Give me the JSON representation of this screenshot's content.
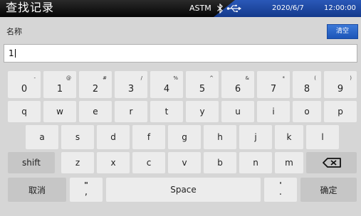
{
  "status_bar": {
    "title": "查找记录",
    "protocol": "ASTM",
    "date": "2020/6/7",
    "time": "12:00:00",
    "icons": [
      "bluetooth-icon",
      "usb-icon"
    ]
  },
  "field": {
    "label": "名称",
    "clear_label": "清空",
    "value": "1"
  },
  "keyboard": {
    "number_row": [
      {
        "main": "0",
        "shift": "-"
      },
      {
        "main": "1",
        "shift": "@"
      },
      {
        "main": "2",
        "shift": "#"
      },
      {
        "main": "3",
        "shift": "/"
      },
      {
        "main": "4",
        "shift": "%"
      },
      {
        "main": "5",
        "shift": "^"
      },
      {
        "main": "6",
        "shift": "&"
      },
      {
        "main": "7",
        "shift": "*"
      },
      {
        "main": "8",
        "shift": "("
      },
      {
        "main": "9",
        "shift": ")"
      }
    ],
    "row_q": [
      "q",
      "w",
      "e",
      "r",
      "t",
      "y",
      "u",
      "i",
      "o",
      "p"
    ],
    "row_a": [
      "a",
      "s",
      "d",
      "f",
      "g",
      "h",
      "j",
      "k",
      "l"
    ],
    "row_z": [
      "z",
      "x",
      "c",
      "v",
      "b",
      "n",
      "m"
    ],
    "shift_label": "shift",
    "cancel_label": "取消",
    "comma_key": {
      "main": ",",
      "shift": "\""
    },
    "space_label": "Space",
    "period_key": {
      "main": ".",
      "shift": "'"
    },
    "confirm_label": "确定"
  }
}
